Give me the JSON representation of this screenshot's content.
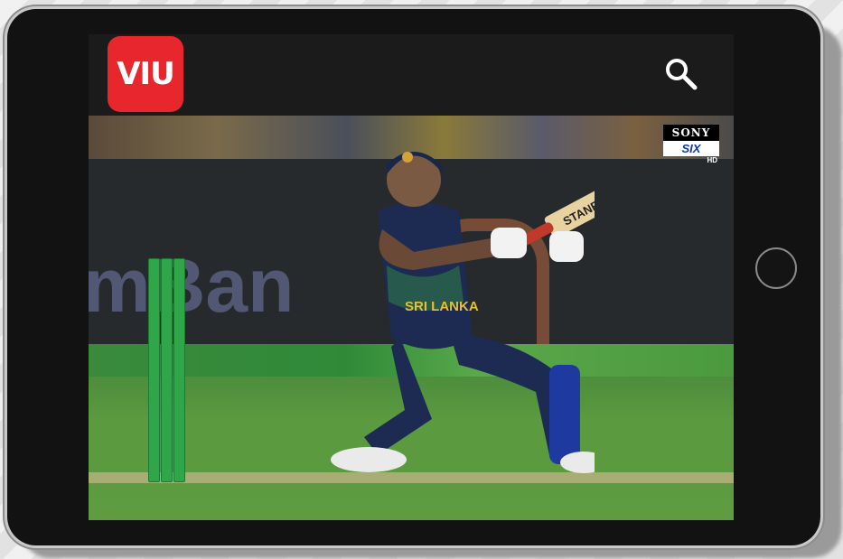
{
  "app": {
    "logo_text": "VIU",
    "brand_color": "#e8262d"
  },
  "header": {
    "search_icon": "search-icon"
  },
  "video": {
    "background_sign_text": "mBan",
    "jersey_text": "SRI LANKA",
    "bat_brand": "STANFORD",
    "broadcaster": {
      "top": "SONY",
      "middle": "SIX",
      "bottom": "HD"
    }
  },
  "device": {
    "home_button_icon": "home-button-icon"
  }
}
